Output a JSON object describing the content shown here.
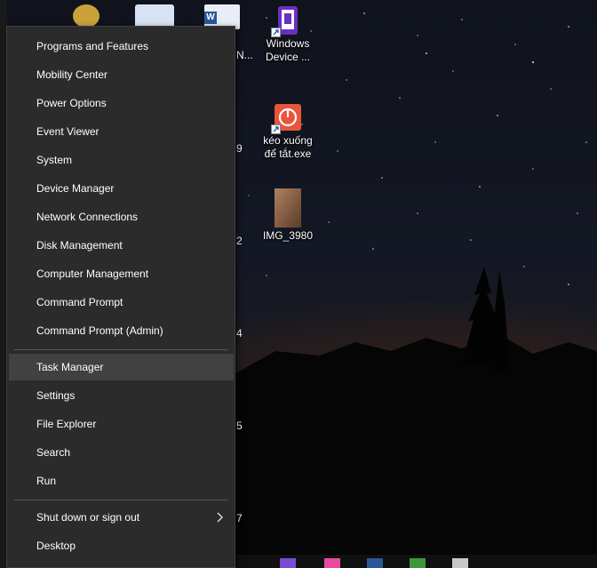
{
  "desktop": {
    "icons": [
      {
        "label": "Windows Device ...",
        "icon": "device-manager-icon"
      },
      {
        "label": "kéo xuống để tắt.exe",
        "icon": "power-shortcut-icon"
      },
      {
        "label": "IMG_3980",
        "icon": "image-thumbnail-icon"
      }
    ],
    "partial_labels": [
      "N...",
      "9",
      "2",
      "4",
      "5",
      "7"
    ]
  },
  "menu": {
    "group1": [
      "Programs and Features",
      "Mobility Center",
      "Power Options",
      "Event Viewer",
      "System",
      "Device Manager",
      "Network Connections",
      "Disk Management",
      "Computer Management",
      "Command Prompt",
      "Command Prompt (Admin)"
    ],
    "group2": [
      "Task Manager",
      "Settings",
      "File Explorer",
      "Search",
      "Run"
    ],
    "group3": [
      "Shut down or sign out",
      "Desktop"
    ],
    "hovered_item": "Task Manager",
    "submenu_item": "Shut down or sign out"
  },
  "colors": {
    "menu_bg": "#2b2b2b",
    "menu_hover": "#414141",
    "menu_text": "#ffffff",
    "separator": "#5a5a5a"
  }
}
